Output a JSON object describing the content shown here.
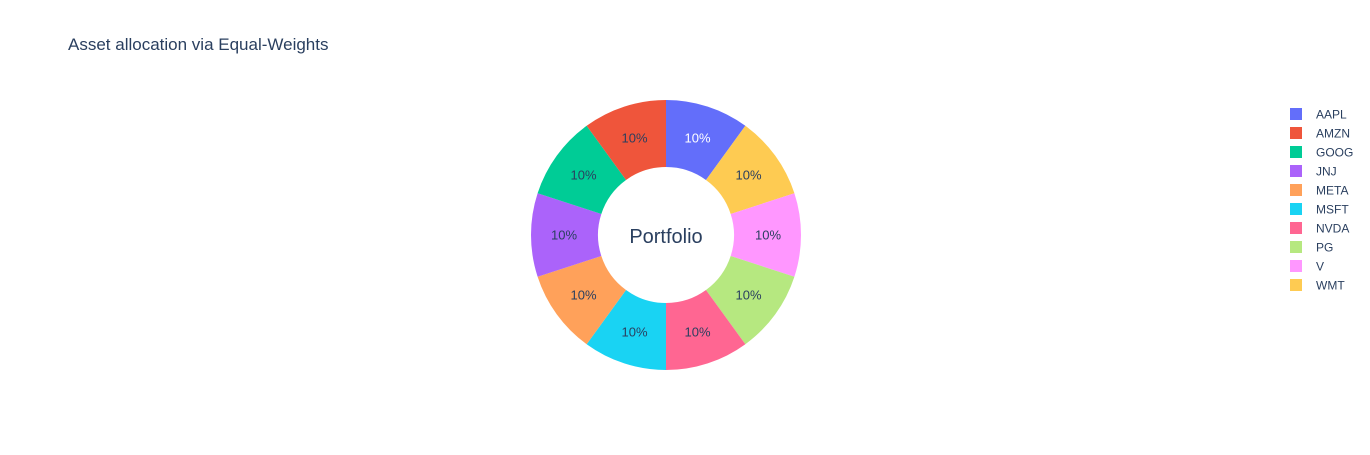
{
  "chart_data": {
    "type": "pie",
    "title": "Asset allocation via Equal-Weights",
    "center_label": "Portfolio",
    "hole": true,
    "legend_position": "right",
    "sort_order": "clockwise from top",
    "slices": [
      {
        "label": "AAPL",
        "value": 10,
        "text": "10%",
        "color": "#636efa",
        "text_color": "#ffffff"
      },
      {
        "label": "WMT",
        "value": 10,
        "text": "10%",
        "color": "#fecb52",
        "text_color": "#2a3f5f"
      },
      {
        "label": "V",
        "value": 10,
        "text": "10%",
        "color": "#ff97ff",
        "text_color": "#2a3f5f"
      },
      {
        "label": "PG",
        "value": 10,
        "text": "10%",
        "color": "#b6e880",
        "text_color": "#2a3f5f"
      },
      {
        "label": "NVDA",
        "value": 10,
        "text": "10%",
        "color": "#ff6692",
        "text_color": "#2a3f5f"
      },
      {
        "label": "MSFT",
        "value": 10,
        "text": "10%",
        "color": "#19d3f3",
        "text_color": "#2a3f5f"
      },
      {
        "label": "META",
        "value": 10,
        "text": "10%",
        "color": "#ffa15a",
        "text_color": "#2a3f5f"
      },
      {
        "label": "JNJ",
        "value": 10,
        "text": "10%",
        "color": "#ab63fa",
        "text_color": "#2a3f5f"
      },
      {
        "label": "GOOG",
        "value": 10,
        "text": "10%",
        "color": "#00cc96",
        "text_color": "#2a3f5f"
      },
      {
        "label": "AMZN",
        "value": 10,
        "text": "10%",
        "color": "#ef553b",
        "text_color": "#2a3f5f"
      }
    ],
    "legend": [
      {
        "label": "AAPL",
        "color": "#636efa"
      },
      {
        "label": "AMZN",
        "color": "#ef553b"
      },
      {
        "label": "GOOG",
        "color": "#00cc96"
      },
      {
        "label": "JNJ",
        "color": "#ab63fa"
      },
      {
        "label": "META",
        "color": "#ffa15a"
      },
      {
        "label": "MSFT",
        "color": "#19d3f3"
      },
      {
        "label": "NVDA",
        "color": "#ff6692"
      },
      {
        "label": "PG",
        "color": "#b6e880"
      },
      {
        "label": "V",
        "color": "#ff97ff"
      },
      {
        "label": "WMT",
        "color": "#fecb52"
      }
    ],
    "colors": {
      "text": "#2a3f5f",
      "background": "#ffffff"
    }
  }
}
